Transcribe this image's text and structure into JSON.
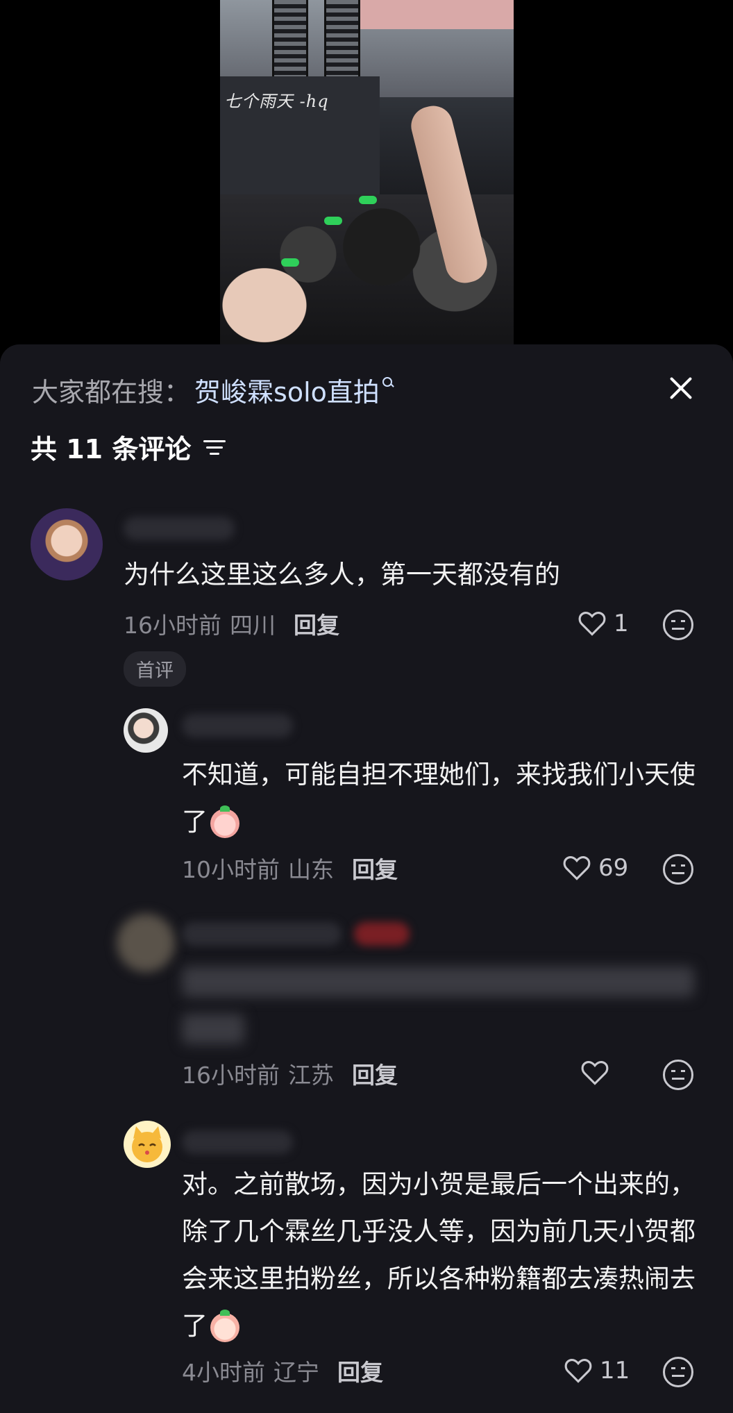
{
  "video": {
    "caption": "七个雨天 -hq"
  },
  "panel": {
    "search_prefix": "大家都在搜：",
    "search_term": "贺峻霖solo直拍",
    "count_label": "共 11 条评论"
  },
  "comments": [
    {
      "text": "为什么这里这么多人，第一天都没有的",
      "time": "16小时前",
      "location": "四川",
      "reply_label": "回复",
      "likes": "1",
      "tag": "首评"
    },
    {
      "text": "不知道，可能自担不理她们，来找我们小天使了",
      "time": "10小时前",
      "location": "山东",
      "reply_label": "回复",
      "likes": "69"
    },
    {
      "time": "16小时前",
      "location": "江苏",
      "reply_label": "回复",
      "likes": ""
    },
    {
      "text": "对。之前散场，因为小贺是最后一个出来的，除了几个霖丝几乎没人等，因为前几天小贺都会来这里拍粉丝，所以各种粉籍都去凑热闹去了",
      "time": "4小时前",
      "location": "辽宁",
      "reply_label": "回复",
      "likes": "11"
    }
  ],
  "colors": {
    "panel_bg": "#16161c",
    "search_term": "#cfe0ff",
    "meta_text": "#8a8a92"
  }
}
